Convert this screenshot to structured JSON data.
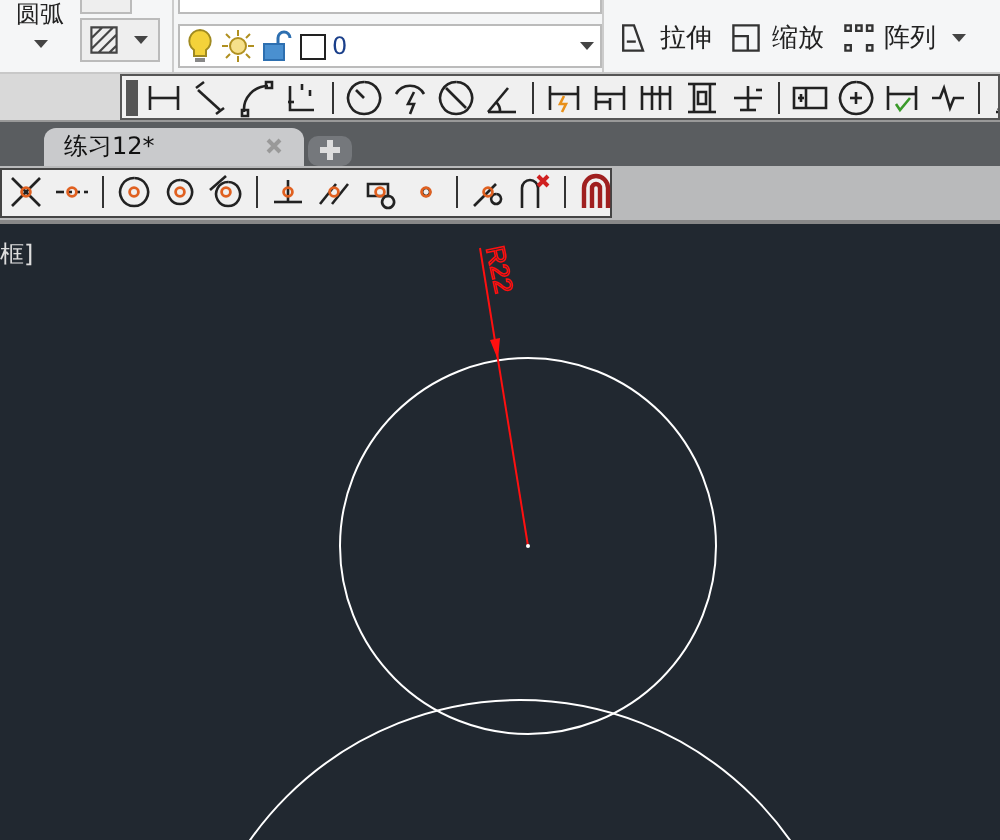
{
  "ribbon": {
    "arc_label": "圆弧",
    "layer": {
      "name": "0"
    },
    "modify": [
      {
        "label": "拉伸",
        "kind": "stretch"
      },
      {
        "label": "缩放",
        "kind": "scale"
      },
      {
        "label": "阵列",
        "kind": "array"
      }
    ]
  },
  "tabs": [
    {
      "label": "练习12*",
      "selected": true
    }
  ],
  "viewport_label": "框]",
  "drawing": {
    "dimension_text": "R22"
  }
}
